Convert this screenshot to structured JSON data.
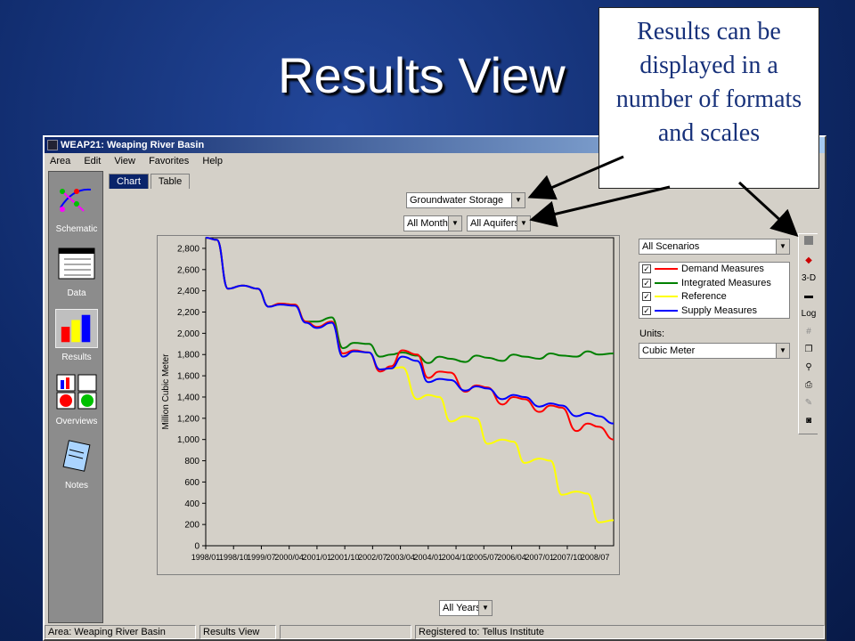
{
  "slide": {
    "title": "Results View",
    "callout": "Results can be displayed in a number of formats and scales"
  },
  "window": {
    "title": "WEAP21: Weaping River Basin",
    "menu": [
      "Area",
      "Edit",
      "View",
      "Favorites",
      "Help"
    ]
  },
  "nav": [
    {
      "label": "Schematic",
      "icon": "schematic-icon"
    },
    {
      "label": "Data",
      "icon": "data-icon"
    },
    {
      "label": "Results",
      "icon": "results-icon",
      "active": true
    },
    {
      "label": "Overviews",
      "icon": "overviews-icon"
    },
    {
      "label": "Notes",
      "icon": "notes-icon"
    }
  ],
  "tabs": [
    {
      "label": "Chart",
      "selected": true
    },
    {
      "label": "Table"
    }
  ],
  "selectors": {
    "variable": "Groundwater Storage",
    "months": "All Months",
    "aquifers": "All Aquifers",
    "scenarios": "All Scenarios",
    "units_label": "Units:",
    "units": "Cubic Meter",
    "years": "All Years"
  },
  "toolbar": {
    "three_d": "3-D",
    "log": "Log"
  },
  "status": {
    "area": "Area: Weaping River Basin",
    "view": "Results View",
    "registered": "Registered to: Tellus Institute"
  },
  "chart_data": {
    "type": "line",
    "ylabel": "Million Cubic Meter",
    "ylim": [
      0,
      2900
    ],
    "yticks": [
      0,
      200,
      400,
      600,
      800,
      1000,
      1200,
      1400,
      1600,
      1800,
      2000,
      2200,
      2400,
      2600,
      2800
    ],
    "xlim": [
      1998.0,
      2009.0
    ],
    "xticks": [
      "1998/01",
      "1998/10",
      "1999/07",
      "2000/04",
      "2001/01",
      "2001/10",
      "2002/07",
      "2003/04",
      "2004/01",
      "2004/10",
      "2005/07",
      "2006/04",
      "2007/01",
      "2007/10",
      "2008/07"
    ],
    "series": [
      {
        "name": "Demand Measures",
        "color": "#ff0000",
        "x": [
          1998.0,
          1998.3,
          1998.6,
          1999.0,
          1999.4,
          1999.7,
          2000.0,
          2000.4,
          2000.7,
          2001.0,
          2001.4,
          2001.7,
          2002.0,
          2002.4,
          2002.7,
          2003.0,
          2003.3,
          2003.7,
          2004.0,
          2004.3,
          2004.6,
          2005.0,
          2005.3,
          2005.6,
          2006.0,
          2006.3,
          2006.6,
          2007.0,
          2007.3,
          2007.6,
          2008.0,
          2008.3,
          2008.6,
          2009.0
        ],
        "y": [
          2900,
          2880,
          2420,
          2450,
          2420,
          2250,
          2280,
          2270,
          2110,
          2060,
          2110,
          1810,
          1840,
          1820,
          1640,
          1690,
          1840,
          1800,
          1580,
          1640,
          1630,
          1450,
          1510,
          1490,
          1330,
          1400,
          1380,
          1260,
          1320,
          1300,
          1080,
          1150,
          1120,
          1000
        ]
      },
      {
        "name": "Integrated Measures",
        "color": "#008000",
        "x": [
          1998.0,
          1998.3,
          1998.6,
          1999.0,
          1999.4,
          1999.7,
          2000.0,
          2000.4,
          2000.7,
          2001.0,
          2001.4,
          2001.7,
          2002.0,
          2002.4,
          2002.7,
          2003.0,
          2003.3,
          2003.7,
          2004.0,
          2004.3,
          2004.6,
          2005.0,
          2005.3,
          2005.6,
          2006.0,
          2006.3,
          2006.6,
          2007.0,
          2007.3,
          2007.6,
          2008.0,
          2008.3,
          2008.6,
          2009.0
        ],
        "y": [
          2900,
          2880,
          2420,
          2450,
          2420,
          2250,
          2280,
          2270,
          2110,
          2110,
          2150,
          1860,
          1910,
          1900,
          1780,
          1800,
          1820,
          1790,
          1720,
          1780,
          1760,
          1730,
          1790,
          1770,
          1740,
          1800,
          1780,
          1760,
          1810,
          1790,
          1780,
          1830,
          1800,
          1810
        ]
      },
      {
        "name": "Reference",
        "color": "#ffff00",
        "x": [
          1998.0,
          1998.3,
          1998.6,
          1999.0,
          1999.4,
          1999.7,
          2000.0,
          2000.4,
          2000.7,
          2001.0,
          2001.4,
          2001.7,
          2002.0,
          2002.4,
          2002.7,
          2003.0,
          2003.3,
          2003.7,
          2004.0,
          2004.3,
          2004.6,
          2005.0,
          2005.3,
          2005.6,
          2006.0,
          2006.3,
          2006.6,
          2007.0,
          2007.3,
          2007.6,
          2008.0,
          2008.3,
          2008.6,
          2009.0
        ],
        "y": [
          2900,
          2880,
          2420,
          2450,
          2420,
          2250,
          2280,
          2270,
          2110,
          2060,
          2110,
          1780,
          1830,
          1820,
          1660,
          1670,
          1680,
          1380,
          1420,
          1400,
          1170,
          1220,
          1200,
          960,
          1000,
          980,
          780,
          820,
          800,
          480,
          510,
          490,
          220,
          240
        ]
      },
      {
        "name": "Supply Measures",
        "color": "#0000ff",
        "x": [
          1998.0,
          1998.3,
          1998.6,
          1999.0,
          1999.4,
          1999.7,
          2000.0,
          2000.4,
          2000.7,
          2001.0,
          2001.4,
          2001.7,
          2002.0,
          2002.4,
          2002.7,
          2003.0,
          2003.3,
          2003.7,
          2004.0,
          2004.3,
          2004.6,
          2005.0,
          2005.3,
          2005.6,
          2006.0,
          2006.3,
          2006.6,
          2007.0,
          2007.3,
          2007.6,
          2008.0,
          2008.3,
          2008.6,
          2009.0
        ],
        "y": [
          2900,
          2880,
          2420,
          2450,
          2420,
          2250,
          2270,
          2260,
          2100,
          2050,
          2100,
          1780,
          1830,
          1820,
          1660,
          1670,
          1780,
          1740,
          1540,
          1570,
          1560,
          1460,
          1500,
          1480,
          1380,
          1420,
          1400,
          1310,
          1340,
          1320,
          1220,
          1250,
          1220,
          1150
        ]
      }
    ]
  }
}
